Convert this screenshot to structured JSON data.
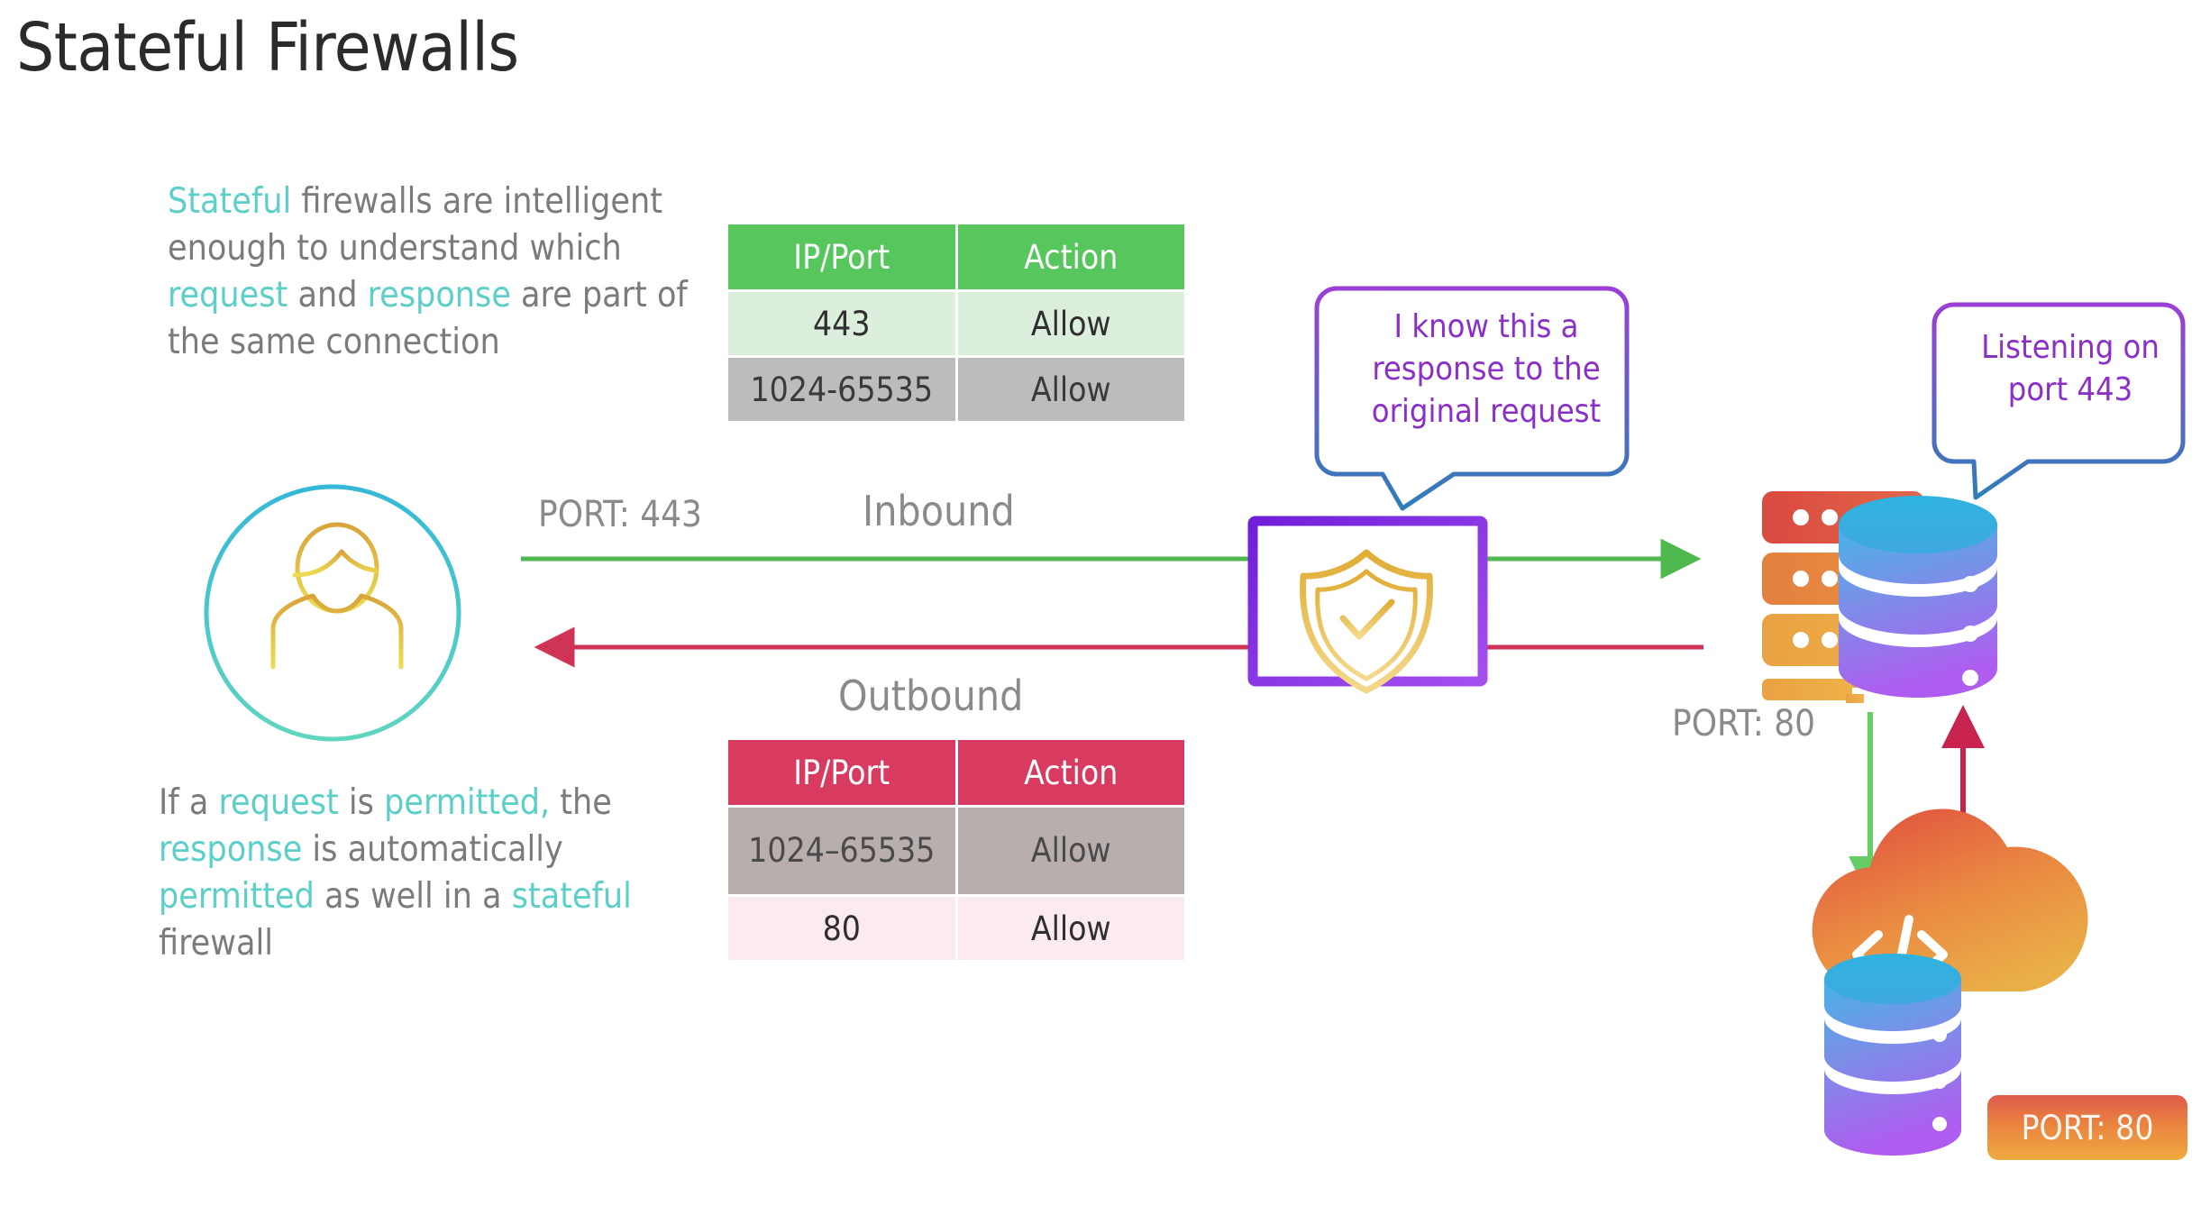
{
  "page": {
    "title": "Stateful Firewalls",
    "background": "#ffffff"
  },
  "colors": {
    "accent_teal": "#5ccfc8",
    "body_gray": "#7b7b7b",
    "inbound_green": "#57c75d",
    "outbound_red": "#d93a60",
    "firewall_purple": "#8a35e0",
    "bubble_purple": "#8b2fc9",
    "bubble_blue": "#2f7fb5",
    "shield_gold": "#e3b23c",
    "badge_orange": "#ea8340"
  },
  "paragraphs": {
    "top": [
      {
        "text": "Stateful",
        "highlight": true
      },
      {
        "text": " firewalls are intelligent enough to understand which ",
        "highlight": false
      },
      {
        "text": "request",
        "highlight": true
      },
      {
        "text": " and ",
        "highlight": false
      },
      {
        "text": "response",
        "highlight": true
      },
      {
        "text": " are part of the same connection",
        "highlight": false
      }
    ],
    "bottom": [
      {
        "text": "If a ",
        "highlight": false
      },
      {
        "text": "request",
        "highlight": true
      },
      {
        "text": " is ",
        "highlight": false
      },
      {
        "text": "permitted,",
        "highlight": true
      },
      {
        "text": " the ",
        "highlight": false
      },
      {
        "text": "response",
        "highlight": true
      },
      {
        "text": " is automatically ",
        "highlight": false
      },
      {
        "text": "permitted",
        "highlight": true
      },
      {
        "text": " as well in a ",
        "highlight": false
      },
      {
        "text": "stateful",
        "highlight": true
      },
      {
        "text": " firewall",
        "highlight": false
      }
    ]
  },
  "tables": {
    "inbound": {
      "direction_label": "Inbound",
      "headers": [
        "IP/Port",
        "Action"
      ],
      "rows": [
        [
          "443",
          "Allow"
        ],
        [
          "1024-65535",
          "Allow"
        ]
      ]
    },
    "outbound": {
      "direction_label": "Outbound",
      "headers": [
        "IP/Port",
        "Action"
      ],
      "rows": [
        [
          "1024–65535",
          "Allow"
        ],
        [
          "80",
          "Allow"
        ]
      ]
    }
  },
  "flow_labels": {
    "client_port": "PORT: 443",
    "server_port": "PORT: 80"
  },
  "bubbles": {
    "firewall": "I know this a response to the original request",
    "server": "Listening on port 443"
  },
  "badges": {
    "app_port": "PORT: 80"
  },
  "icons": {
    "user": "user-avatar-icon",
    "firewall": "firewall-brick-wall-icon",
    "shield": "shield-check-icon",
    "server": "server-rack-database-icon",
    "cloud_app": "cloud-code-database-icon"
  }
}
